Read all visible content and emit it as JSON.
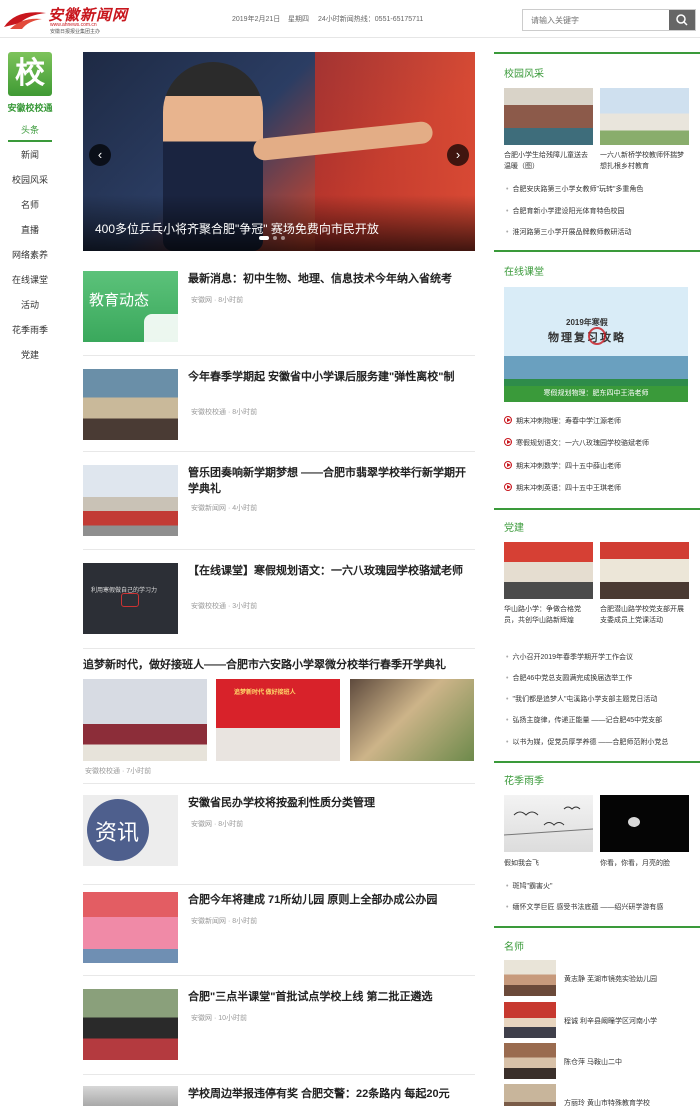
{
  "header": {
    "logo_name": "安徽新闻网",
    "logo_url": "www.ahnews.com.cn",
    "logo_slogan": "安徽日报报业集团主办",
    "date": "2019年2月21日",
    "weekday": "星期四",
    "hotline": "24小时新闻热线：0551-65175711",
    "search_placeholder": "请输入关键字"
  },
  "leftnav": {
    "logo_char": "校",
    "title": "安徽校校通",
    "items": [
      "头条",
      "新闻",
      "校园风采",
      "名师",
      "直播",
      "网络素养",
      "在线课堂",
      "活动",
      "花季雨季",
      "党建"
    ]
  },
  "slider": {
    "caption": "400多位乒乓小将齐聚合肥\"争冠\" 赛场免费向市民开放",
    "prev": "‹",
    "next": "›"
  },
  "feed": [
    {
      "title": "最新消息：初中生物、地理、信息技术今年纳入省统考",
      "meta": "安徽网 · 8小时前",
      "thumb_text": "教育动态"
    },
    {
      "title": "今年春季学期起 安徽省中小学课后服务建\"弹性离校\"制",
      "meta": "安徽校校通 · 8小时前"
    },
    {
      "title": "管乐团奏响新学期梦想 ——合肥市翡翠学校举行新学期开学典礼",
      "meta": "安徽新闻网 · 4小时前"
    },
    {
      "title": "【在线课堂】寒假规划语文：一六八玫瑰园学校骆斌老师",
      "meta": "安徽校校通 · 3小时前",
      "thumb_text": "利用寒假做自己的学习力"
    },
    {
      "title": "安徽省民办学校将按盈利性质分类管理",
      "meta": "安徽网 · 8小时前",
      "thumb_text": "资讯"
    },
    {
      "title": "合肥今年将建成 71所幼儿园 原则上全部办成公办园",
      "meta": "安徽新闻网 · 8小时前"
    },
    {
      "title": "合肥\"三点半课堂\"首批试点学校上线 第二批正遴选",
      "meta": "安徽网 · 10小时前"
    },
    {
      "title": "学校周边举报违停有奖 合肥交警：22条路内 每起20元"
    }
  ],
  "feature": {
    "title": "追梦新时代，做好接班人——合肥市六安路小学翠微分校举行春季开学典礼",
    "meta": "安徽校校通 · 7小时前",
    "banner_text": "追梦新时代 做好接班人"
  },
  "right": {
    "campus": {
      "title": "校园风采",
      "pics": [
        {
          "caption": "合肥小学生给残障儿童送去温暖（图）"
        },
        {
          "caption": "一六八新桥学校教师怀揣梦想扎根乡村教育"
        }
      ],
      "list": [
        "合肥安庆路第三小学女教师\"玩转\"多重角色",
        "合肥育新小学建设阳光体育特色校园",
        "淮河路第三小学开展品牌教师教研活动"
      ]
    },
    "online": {
      "title": "在线课堂",
      "video_title": "2019年寒假",
      "video_sub": "物理复习攻略",
      "video_caption": "寒假规划物理：肥东四中王浩老师",
      "list": [
        "期末冲刺物理：寿春中学江源老师",
        "寒假规划语文：一六八玫瑰园学校骆斌老师",
        "期末冲刺数学：四十五中薛山老师",
        "期末冲刺英语：四十五中王琪老师"
      ]
    },
    "party": {
      "title": "党建",
      "pics": [
        {
          "caption": "华山路小学：争做合格党员，共创华山路新辉煌"
        },
        {
          "caption": "合肥潜山路学校党支部开展支委成员上党课活动"
        }
      ],
      "list": [
        "六小召开2019年春季学期开学工作会议",
        "合肥46中党总支圆满完成换届选举工作",
        "\"我们都是追梦人\"屯溪路小学支部主题党日活动",
        "弘扬主旋律，传递正能量 ——记合肥45中党支部",
        "以书为媒，促党员厚学养德 ——合肥师范附小党总"
      ]
    },
    "youth": {
      "title": "花季雨季",
      "pics": [
        {
          "caption": "假如我会飞"
        },
        {
          "caption": "你看，你看，月亮的脸"
        }
      ],
      "list": [
        "斑鸠\"霸害火\"",
        "缅怀文学巨匠 感受书法底蕴 ——绍兴研学游有感"
      ]
    },
    "teachers": {
      "title": "名师",
      "list": [
        "黄志静 芜湖市镜苑实验幼儿园",
        "程诚 利辛县阚疃学区河南小学",
        "陈仓萍 马鞍山二中",
        "方丽玲 黄山市特殊教育学校"
      ]
    }
  },
  "colors": {
    "brand_red": "#c8161d",
    "accent_green": "#3a9a3a"
  }
}
